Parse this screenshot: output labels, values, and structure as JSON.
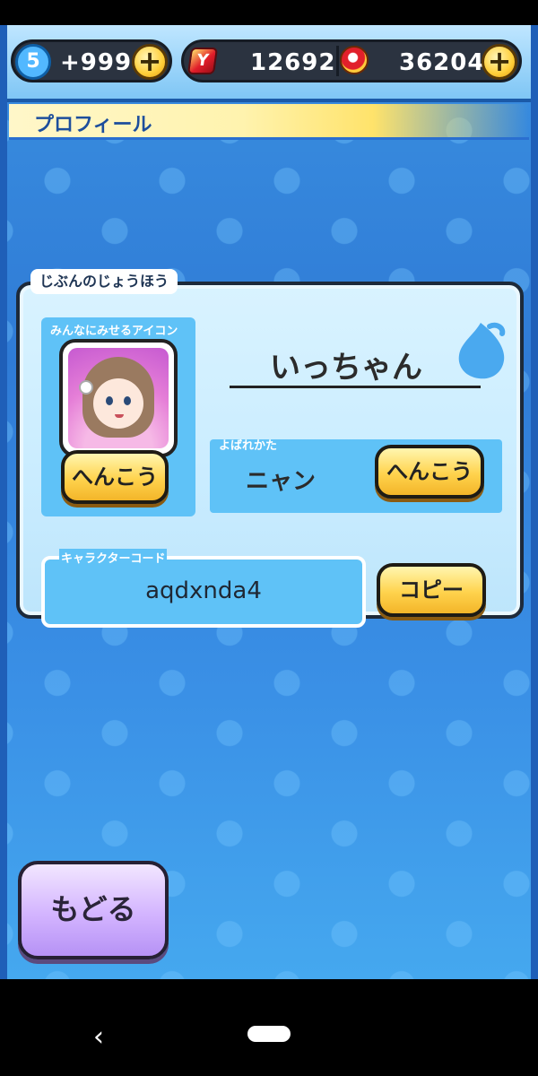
{
  "topbar": {
    "level": "5",
    "stamina": "+999",
    "gems": "12692",
    "coins": "36204",
    "add_label": "+"
  },
  "page_title": "プロフィール",
  "profile": {
    "section_label": "じぶんのじょうほう",
    "icon_label": "みんなにみせるアイコン",
    "change_icon_button": "へんこう",
    "name": "いっちゃん",
    "callname_label": "よばれかた",
    "callname": "ニャン",
    "change_callname_button": "へんこう",
    "character_code_label": "キャラクターコード",
    "character_code": "aqdxnda4",
    "copy_button": "コピー"
  },
  "back_button": "もどる",
  "nav": {
    "back_glyph": "‹"
  },
  "colors": {
    "background": "#2f7bd6",
    "panel": "#d9f3ff",
    "yellow_button": "#ffd34d",
    "back_button": "#d3b4ff",
    "title_text": "#1d4e9c"
  },
  "icons": [
    "level-drop-icon",
    "plus-icon",
    "gem-icon",
    "coin-purse-icon",
    "drop-icon",
    "avatar",
    "nav-back-icon",
    "nav-home-icon"
  ]
}
